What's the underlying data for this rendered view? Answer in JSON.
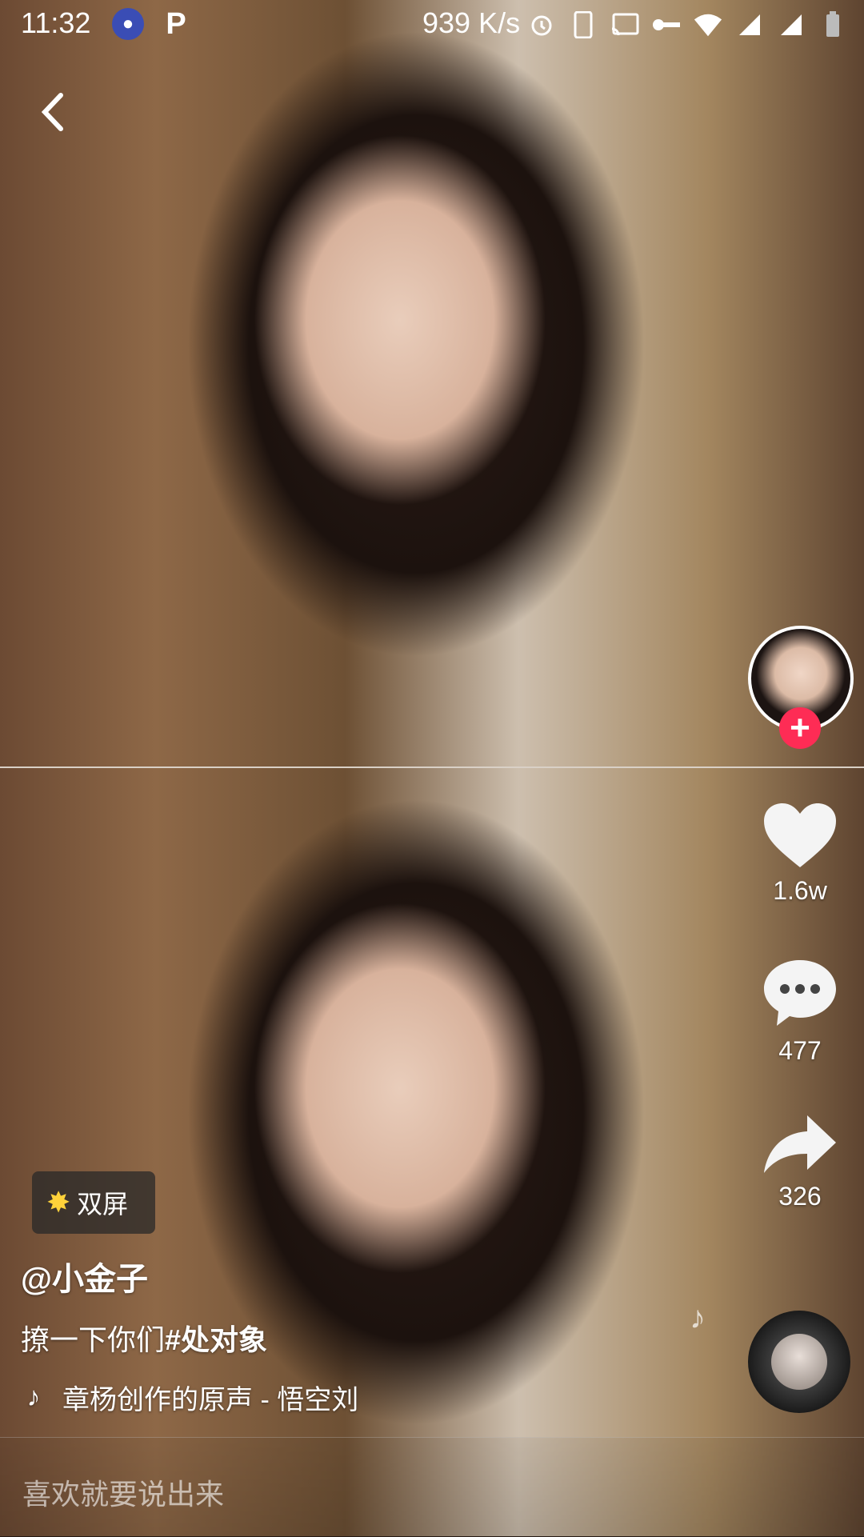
{
  "status_bar": {
    "time": "11:32",
    "network_speed": "939 K/s",
    "icons": [
      "video-app-icon",
      "p-app-icon",
      "alarm-icon",
      "phone-icon",
      "cast-icon",
      "key-icon",
      "wifi-icon",
      "signal-icon",
      "signal-icon",
      "battery-icon"
    ]
  },
  "post": {
    "badge_label": "双屏",
    "username": "@小金子",
    "caption_text": "撩一下你们",
    "hashtag": "#处对象",
    "music_title": "章杨创作的原声 - 悟空刘"
  },
  "rail": {
    "likes": "1.6w",
    "comments": "477",
    "shares": "326",
    "follow_symbol": "+"
  },
  "comment_bar": {
    "placeholder": "喜欢就要说出来"
  },
  "colors": {
    "accent": "#fe2c55",
    "badge_icon": "#ffd23a"
  }
}
